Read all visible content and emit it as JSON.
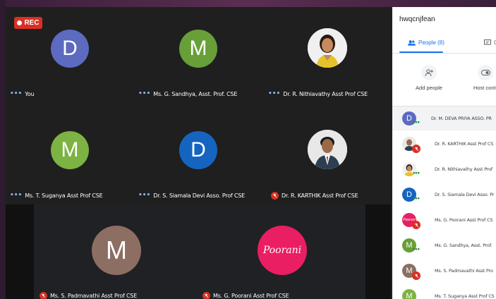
{
  "recording": {
    "label": "REC"
  },
  "tiles": [
    {
      "initial": "D",
      "color": "#5c6bc0",
      "name": "You",
      "status": "dots"
    },
    {
      "initial": "M",
      "color": "#689f38",
      "name": "Ms. G. Sandhya, Asst. Prof. CSE",
      "status": "dots"
    },
    {
      "initial": "",
      "color": "#e8e8e8",
      "name": "Dr. R. Nithiavathy Asst Prof CSE",
      "status": "dots",
      "photo": "woman"
    },
    {
      "initial": "M",
      "color": "#7cb342",
      "name": "Ms. T. Suganya Asst Prof CSE",
      "status": "dots"
    },
    {
      "initial": "D",
      "color": "#1565c0",
      "name": "Dr. S. Siamala Devi Asso. Prof CSE",
      "status": "dots"
    },
    {
      "initial": "",
      "color": "#e8e8e8",
      "name": "Dr. R. KARTHIK Asst Prof CSE",
      "status": "muted",
      "photo": "man"
    },
    {
      "initial": "M",
      "color": "#8d6e63",
      "name": "Ms. S. Padmavathi Asst Prof CSE",
      "status": "muted"
    },
    {
      "initial": "Poorani",
      "color": "#e91e63",
      "name": "Ms. G. Poorani Asst Prof CSE",
      "status": "muted"
    }
  ],
  "panel": {
    "title": "hwqcnjfean",
    "tab_people": "People (8)",
    "tab_chat": "C",
    "add_people": "Add people",
    "host_controls": "Host contr",
    "participants": [
      {
        "initial": "D",
        "color": "#5c6bc0",
        "name": "Dr. M. DEVA PRIYA ASSO. PR",
        "status": "dots"
      },
      {
        "initial": "",
        "color": "#cfd8dc",
        "name": "Dr. R. KARTHIK Asst Prof CS",
        "status": "muted",
        "photo": "man"
      },
      {
        "initial": "",
        "color": "#f5f5f5",
        "name": "Dr. R. Nithiavathy Asst Prof",
        "status": "dots",
        "photo": "woman"
      },
      {
        "initial": "D",
        "color": "#1565c0",
        "name": "Dr. S. Siamala Devi Asso. Pr",
        "status": "dots"
      },
      {
        "initial": "Poorani",
        "color": "#e91e63",
        "name": "Ms. G. Poorani Asst Prof CS",
        "status": "muted"
      },
      {
        "initial": "M",
        "color": "#689f38",
        "name": "Ms. G. Sandhya, Asst. Prof.",
        "status": "dots"
      },
      {
        "initial": "M",
        "color": "#8d6e63",
        "name": "Ms. S. Padmavathi Asst Pro",
        "status": "muted"
      },
      {
        "initial": "M",
        "color": "#7cb342",
        "name": "Ms. T. Suganya Asst Prof CS",
        "status": "dots"
      }
    ]
  }
}
